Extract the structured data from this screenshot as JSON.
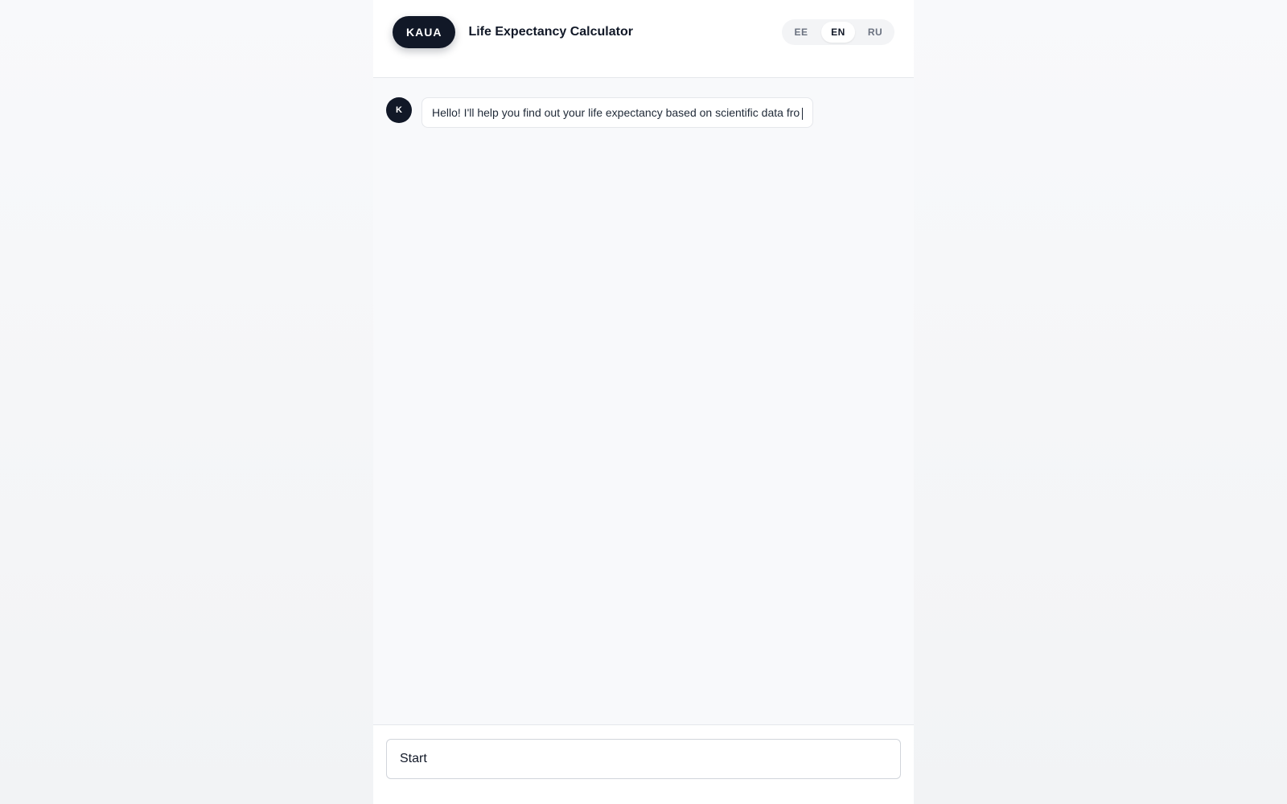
{
  "header": {
    "logo": "KAUA",
    "title": "Life Expectancy Calculator",
    "languages": [
      {
        "code": "EE",
        "active": false
      },
      {
        "code": "EN",
        "active": true
      },
      {
        "code": "RU",
        "active": false
      }
    ]
  },
  "chat": {
    "messages": [
      {
        "avatar": "K",
        "text": "Hello! I'll help you find out your life expectancy based on scientific data fro"
      }
    ]
  },
  "footer": {
    "input_value": "Start"
  },
  "colors": {
    "brand": "#111827",
    "background": "#f8f9fb",
    "border": "#e5e7eb"
  },
  "icons": {
    "avatar": "assistant-avatar"
  }
}
